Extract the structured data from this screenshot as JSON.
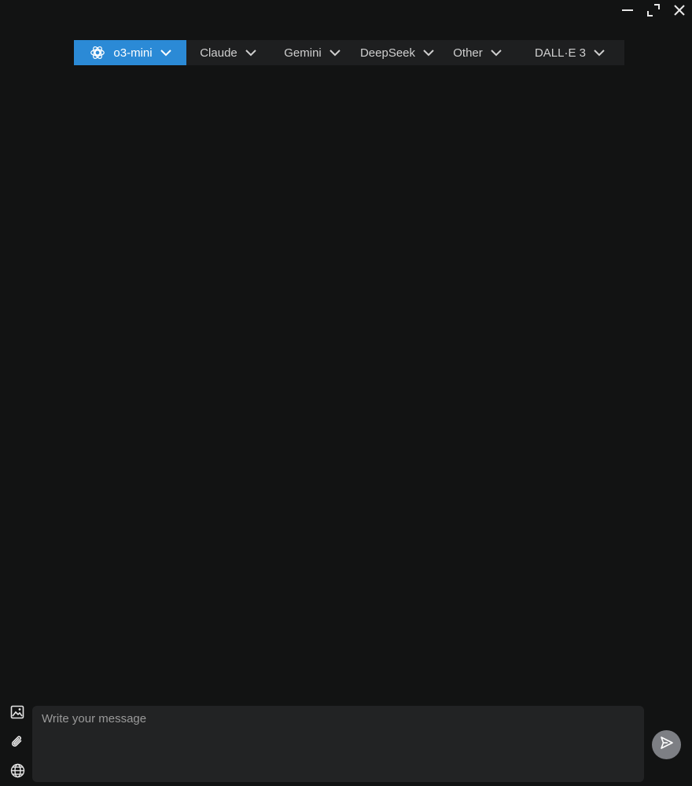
{
  "window": {
    "controls": [
      {
        "name": "minimize",
        "icon": "minimize-icon"
      },
      {
        "name": "maximize",
        "icon": "maximize-icon"
      },
      {
        "name": "close",
        "icon": "close-icon"
      }
    ]
  },
  "model_bar": {
    "tabs": [
      {
        "label": "o3-mini",
        "active": true,
        "icon": "openai-logo-icon"
      },
      {
        "label": "Claude",
        "active": false
      },
      {
        "label": "Gemini",
        "active": false
      },
      {
        "label": "DeepSeek",
        "active": false
      },
      {
        "label": "Other",
        "active": false
      },
      {
        "label": "DALL·E 3",
        "active": false
      }
    ]
  },
  "composer": {
    "placeholder": "Write your message",
    "value": "",
    "tools": [
      {
        "name": "image",
        "icon": "image-icon"
      },
      {
        "name": "attach",
        "icon": "paperclip-icon"
      },
      {
        "name": "web",
        "icon": "globe-icon"
      }
    ],
    "send_icon": "send-icon"
  },
  "colors": {
    "background": "#121313",
    "accent": "#2b8ad6",
    "bar": "#1e1f20",
    "input": "#222324",
    "send_button": "#7d7f84"
  }
}
